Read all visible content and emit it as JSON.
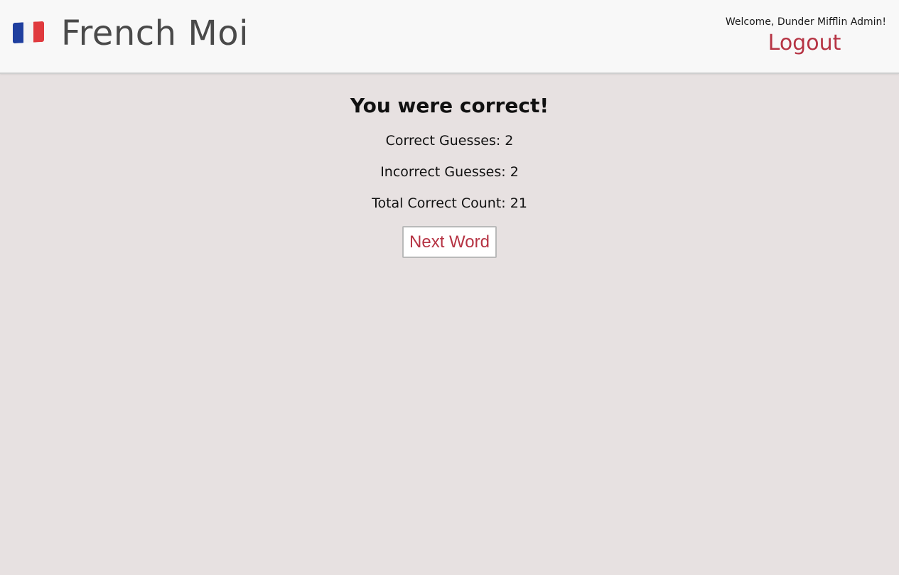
{
  "header": {
    "title": "French Moi",
    "flag_icon": "france-flag-icon",
    "welcome_text": "Welcome, Dunder Mifflin Admin!",
    "logout_label": "Logout"
  },
  "main": {
    "result_heading": "You were correct!",
    "correct_guesses": "Correct Guesses: 2",
    "incorrect_guesses": "Incorrect Guesses: 2",
    "total_correct_count": "Total Correct Count: 21",
    "next_button_label": "Next Word"
  },
  "colors": {
    "accent": "#b63444",
    "background": "#e7e1e1",
    "header_background": "#f8f8f8",
    "title_text": "#4a4a4a"
  }
}
